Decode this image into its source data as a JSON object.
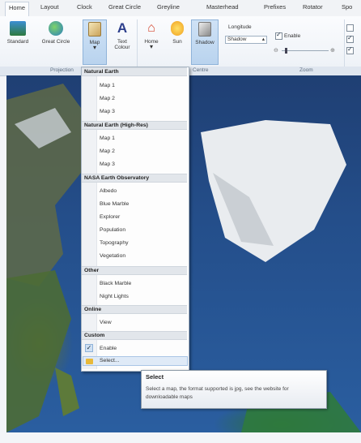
{
  "tabs": [
    "Home",
    "Layout",
    "Clock",
    "Great Circle",
    "Greyline",
    "Masterhead",
    "Prefixes",
    "Rotator",
    "Spo"
  ],
  "ribbon": {
    "buttons": [
      {
        "label": "Standard",
        "icon": "standard-map-icon"
      },
      {
        "label": "Great Circle",
        "icon": "globe-icon"
      },
      {
        "label": "Map",
        "icon": "map-icon"
      },
      {
        "label": "Text Colour",
        "icon": "text-colour-icon"
      },
      {
        "label": "Home",
        "icon": "home-icon"
      },
      {
        "label": "Sun",
        "icon": "sun-icon"
      },
      {
        "label": "Shadow",
        "icon": "shadow-icon"
      }
    ],
    "longitude_label": "Longitude",
    "shadow_combo": "Shadow",
    "enable_label": "Enable",
    "groups": [
      "Projection",
      "Centre",
      "Zoom"
    ]
  },
  "menu": {
    "sections": [
      {
        "header": "Natural Earth",
        "items": [
          "Map 1",
          "Map 2",
          "Map 3"
        ]
      },
      {
        "header": "Natural Earth (High-Res)",
        "items": [
          "Map 1",
          "Map 2",
          "Map 3"
        ]
      },
      {
        "header": "NASA Earth Observatory",
        "items": [
          "Albedo",
          "Blue Marble",
          "Explorer",
          "Population",
          "Topography",
          "Vegetation"
        ]
      },
      {
        "header": "Other",
        "items": [
          "Black Marble",
          "Night Lights"
        ]
      },
      {
        "header": "Online",
        "items": [
          "View"
        ]
      },
      {
        "header": "Custom",
        "items": [
          "Enable",
          "Select..."
        ]
      }
    ]
  },
  "tooltip": {
    "title": "Select",
    "body": "Select a map, the format supported is jpg, see the website for downloadable maps"
  },
  "colors": {
    "accent": "#8fb3d9",
    "ocean": "#244e8a",
    "highlight": "#dfeaf7"
  }
}
